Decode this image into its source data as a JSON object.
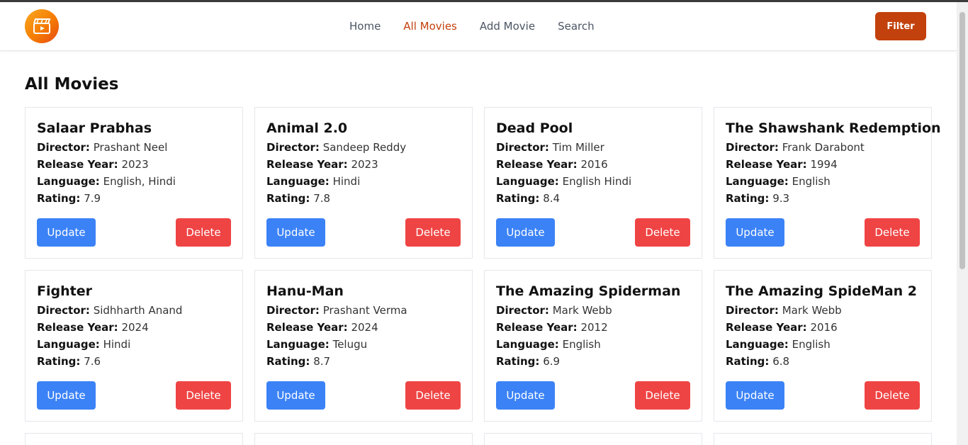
{
  "nav": {
    "links": [
      {
        "label": "Home",
        "active": false
      },
      {
        "label": "All Movies",
        "active": true
      },
      {
        "label": "Add Movie",
        "active": false
      },
      {
        "label": "Search",
        "active": false
      }
    ],
    "filter_label": "Filter",
    "logo_icon": "clapperboard-play-icon"
  },
  "page": {
    "title": "All Movies"
  },
  "labels": {
    "director": "Director:",
    "release_year": "Release Year:",
    "language": "Language:",
    "rating": "Rating:",
    "update": "Update",
    "delete": "Delete"
  },
  "movies": [
    {
      "title": "Salaar Prabhas",
      "director": "Prashant Neel",
      "year": "2023",
      "language": "English, Hindi",
      "rating": "7.9"
    },
    {
      "title": "Animal 2.0",
      "director": "Sandeep Reddy",
      "year": "2023",
      "language": "Hindi",
      "rating": "7.8"
    },
    {
      "title": "Dead Pool",
      "director": "Tim Miller",
      "year": "2016",
      "language": "English Hindi",
      "rating": "8.4"
    },
    {
      "title": "The Shawshank Redemption",
      "director": "Frank Darabont",
      "year": "1994",
      "language": "English",
      "rating": "9.3"
    },
    {
      "title": "Fighter",
      "director": "Sidhharth Anand",
      "year": "2024",
      "language": "Hindi",
      "rating": "7.6"
    },
    {
      "title": "Hanu-Man",
      "director": "Prashant Verma",
      "year": "2024",
      "language": "Telugu",
      "rating": "8.7"
    },
    {
      "title": "The Amazing Spiderman",
      "director": "Mark Webb",
      "year": "2012",
      "language": "English",
      "rating": "6.9"
    },
    {
      "title": "The Amazing SpideMan 2",
      "director": "Mark Webb",
      "year": "2016",
      "language": "English",
      "rating": "6.8"
    }
  ],
  "colors": {
    "accent": "#c2410c",
    "update": "#3b82f6",
    "delete": "#ef4444"
  }
}
